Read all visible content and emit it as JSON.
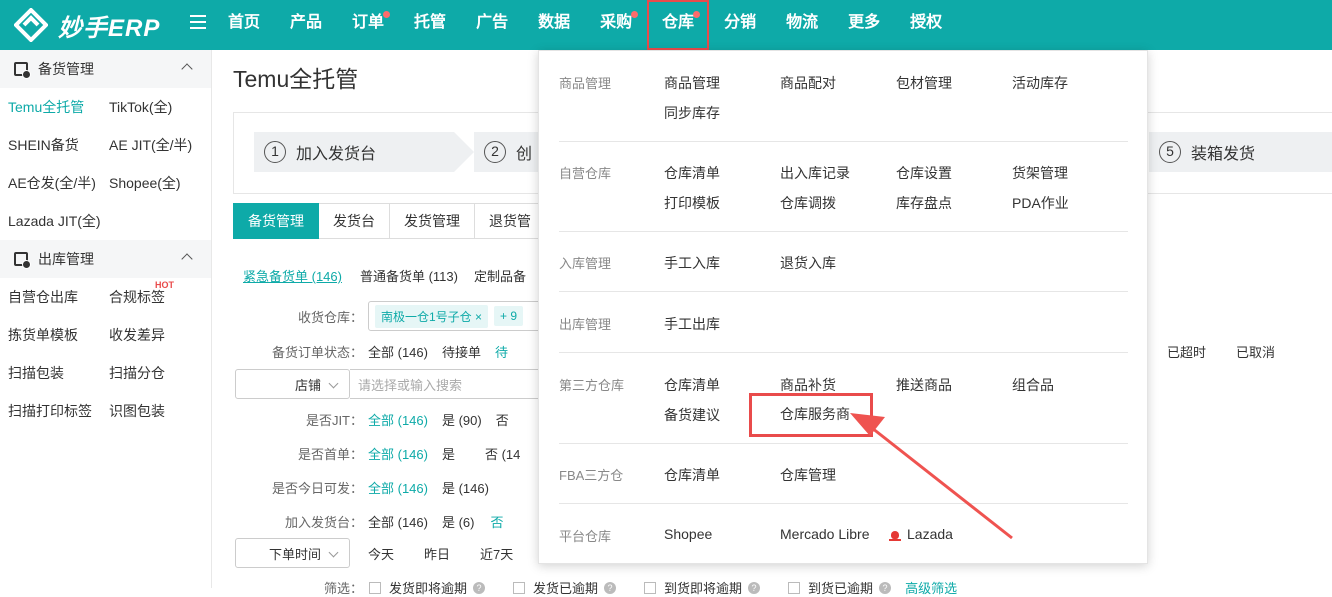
{
  "brand": {
    "name": "妙手ERP"
  },
  "nav": [
    {
      "label": "首页",
      "dot": false,
      "active": false
    },
    {
      "label": "产品",
      "dot": false,
      "active": false
    },
    {
      "label": "订单",
      "dot": true,
      "active": false
    },
    {
      "label": "托管",
      "dot": false,
      "active": false
    },
    {
      "label": "广告",
      "dot": false,
      "active": false
    },
    {
      "label": "数据",
      "dot": false,
      "active": false
    },
    {
      "label": "采购",
      "dot": true,
      "active": false
    },
    {
      "label": "仓库",
      "dot": true,
      "active": true
    },
    {
      "label": "分销",
      "dot": false,
      "active": false
    },
    {
      "label": "物流",
      "dot": false,
      "active": false
    },
    {
      "label": "更多",
      "dot": false,
      "active": false
    },
    {
      "label": "授权",
      "dot": false,
      "active": false
    }
  ],
  "sidebar": {
    "sections": [
      {
        "title": "备货管理",
        "items": [
          "Temu全托管",
          "TikTok(全)",
          "SHEIN备货",
          "AE JIT(全/半)",
          "AE仓发(全/半)",
          "Shopee(全)",
          "Lazada JIT(全)"
        ]
      },
      {
        "title": "出库管理",
        "items": [
          "自营仓出库",
          "合规标签",
          "拣货单模板",
          "收发差异",
          "扫描包装",
          "扫描分仓",
          "扫描打印标签",
          "识图包装"
        ]
      }
    ],
    "hot_label": "HOT"
  },
  "main": {
    "title": "Temu全托管",
    "steps": [
      {
        "num": "1",
        "label": "加入发货台"
      },
      {
        "num": "2",
        "label": "创"
      },
      {
        "num": "5",
        "label": "装箱发货"
      }
    ],
    "tabs": [
      "备货管理",
      "发货台",
      "发货管理",
      "退货管"
    ],
    "subtabs": {
      "urgent": "紧急备货单 (146)",
      "normal": "普通备货单 (113)",
      "custom": "定制品备"
    },
    "filters": {
      "warehouse_label": "收货仓库：",
      "warehouse_chip": "南极一仓1号子仓",
      "warehouse_more": "+ 9",
      "status_label": "备货订单状态：",
      "status_all": "全部 (146)",
      "status_pending": "待接单",
      "status_partial": "待",
      "status_overdue": "已超时",
      "status_cancelled": "已取消",
      "store_select": "店铺",
      "store_placeholder": "请选择或输入搜索",
      "jit_label": "是否JIT：",
      "jit_all": "全部 (146)",
      "jit_yes": "是 (90)",
      "jit_no": "否",
      "first_label": "是否首单：",
      "first_all": "全部 (146)",
      "first_yes": "是",
      "first_no": "否 (14",
      "today_label": "是否今日可发：",
      "today_all": "全部 (146)",
      "today_yes": "是 (146)",
      "desk_label": "加入发货台：",
      "desk_all": "全部 (146)",
      "desk_yes": "是 (6)",
      "desk_no": "否",
      "time_select": "下单时间",
      "time_today": "今天",
      "time_yesterday": "昨日",
      "time_7days": "近7天",
      "screen_label": "筛选：",
      "cb1": "发货即将逾期",
      "cb2": "发货已逾期",
      "cb3": "到货即将逾期",
      "cb4": "到货已逾期",
      "advanced": "高级筛选"
    }
  },
  "dropdown": {
    "sections": [
      {
        "title": "商品管理",
        "items": [
          "商品管理",
          "商品配对",
          "包材管理",
          "活动库存",
          "同步库存"
        ]
      },
      {
        "title": "自营仓库",
        "items": [
          "仓库清单",
          "出入库记录",
          "仓库设置",
          "货架管理",
          "打印模板",
          "仓库调拨",
          "库存盘点",
          "PDA作业"
        ]
      },
      {
        "title": "入库管理",
        "items": [
          "手工入库",
          "退货入库"
        ]
      },
      {
        "title": "出库管理",
        "items": [
          "手工出库"
        ]
      },
      {
        "title": "第三方仓库",
        "items": [
          "仓库清单",
          "商品补货",
          "推送商品",
          "组合品",
          "备货建议",
          "仓库服务商"
        ]
      },
      {
        "title": "FBA三方仓",
        "items": [
          "仓库清单",
          "仓库管理"
        ]
      },
      {
        "title": "平台仓库",
        "items": [
          "Shopee",
          "Mercado Libre",
          "Lazada"
        ]
      }
    ]
  }
}
